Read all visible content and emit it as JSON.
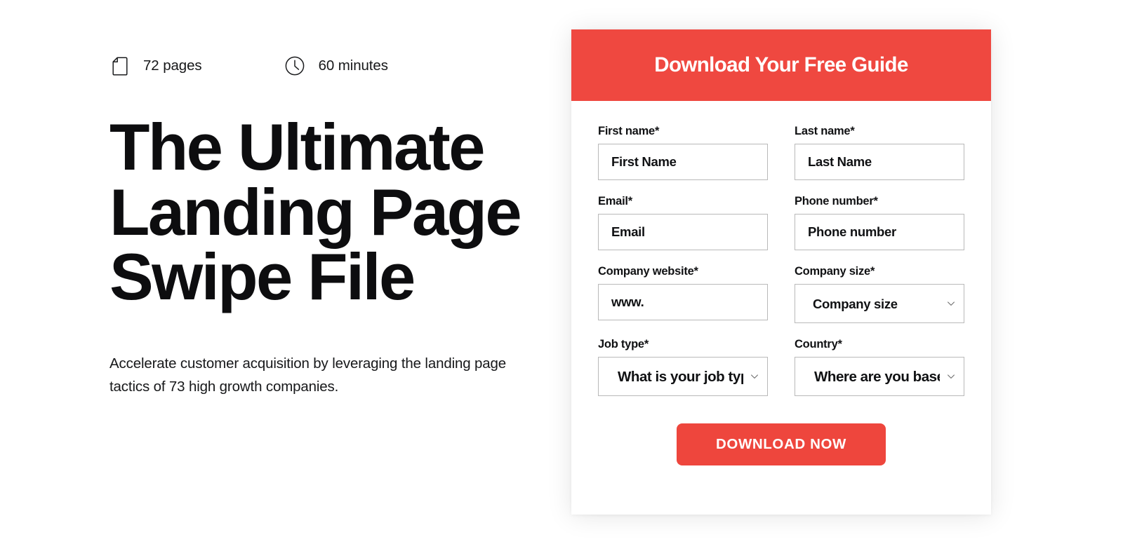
{
  "theme": {
    "brand_red": "#ef4840",
    "button_red": "#ee463d",
    "text_dark": "#101113",
    "border_gray": "#b9b9b9",
    "page_background": "#ffffff"
  },
  "hero": {
    "meta": [
      {
        "icon": "document-icon",
        "label": "72 pages"
      },
      {
        "icon": "clock-icon",
        "label": "60 minutes"
      }
    ],
    "title": "The Ultimate Landing Page Swipe File",
    "subtitle": "Accelerate customer acquisition by leveraging the landing page tactics of 73 high growth companies."
  },
  "form": {
    "header_title": "Download Your Free Guide",
    "fields": {
      "first_name": {
        "label": "First name*",
        "placeholder": "First Name",
        "value": ""
      },
      "last_name": {
        "label": "Last name*",
        "placeholder": "Last Name",
        "value": ""
      },
      "email": {
        "label": "Email*",
        "placeholder": "Email",
        "value": ""
      },
      "phone": {
        "label": "Phone number*",
        "placeholder": "Phone number",
        "value": ""
      },
      "company_website": {
        "label": "Company website*",
        "placeholder": "www.",
        "value": ""
      },
      "company_size": {
        "label": "Company size*",
        "selected": "Company size",
        "icon": "chevron-down-icon"
      },
      "job_type": {
        "label": "Job type*",
        "selected": "What is your job type?",
        "icon": "chevron-down-icon"
      },
      "country": {
        "label": "Country*",
        "selected": "Where are you based?",
        "icon": "chevron-down-icon"
      }
    },
    "submit_label": "DOWNLOAD NOW"
  }
}
